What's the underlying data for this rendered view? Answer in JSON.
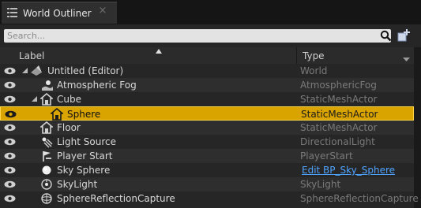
{
  "tab": {
    "title": "World Outliner",
    "close_glyph": "×"
  },
  "search": {
    "placeholder": "Search...",
    "value": ""
  },
  "columns": {
    "label": "Label",
    "type": "Type"
  },
  "rows": [
    {
      "label": "Untitled (Editor)",
      "type": "World",
      "icon": "world-icon",
      "depth": 0,
      "expanded": true
    },
    {
      "label": "Atmospheric Fog",
      "type": "AtmosphericFog",
      "icon": "atmospheric-fog-icon",
      "depth": 1
    },
    {
      "label": "Cube",
      "type": "StaticMeshActor",
      "icon": "static-mesh-icon",
      "depth": 1,
      "expanded": true
    },
    {
      "label": "Sphere",
      "type": "StaticMeshActor",
      "icon": "static-mesh-icon",
      "depth": 2,
      "selected": true
    },
    {
      "label": "Floor",
      "type": "StaticMeshActor",
      "icon": "static-mesh-icon",
      "depth": 1
    },
    {
      "label": "Light Source",
      "type": "DirectionalLight",
      "icon": "directional-light-icon",
      "depth": 1
    },
    {
      "label": "Player Start",
      "type": "PlayerStart",
      "icon": "player-start-icon",
      "depth": 1
    },
    {
      "label": "Sky Sphere",
      "type": "Edit BP_Sky_Sphere",
      "icon": "sky-sphere-icon",
      "depth": 1,
      "type_is_link": true
    },
    {
      "label": "SkyLight",
      "type": "SkyLight",
      "icon": "sky-light-icon",
      "depth": 1
    },
    {
      "label": "SphereReflectionCapture",
      "type": "SphereReflectionCapture",
      "icon": "reflection-capture-icon",
      "depth": 1
    }
  ],
  "colors": {
    "panel_bg": "#262626",
    "selection": "#d9a400",
    "link": "#4fa3ff",
    "type_text": "#7a7a7a"
  }
}
